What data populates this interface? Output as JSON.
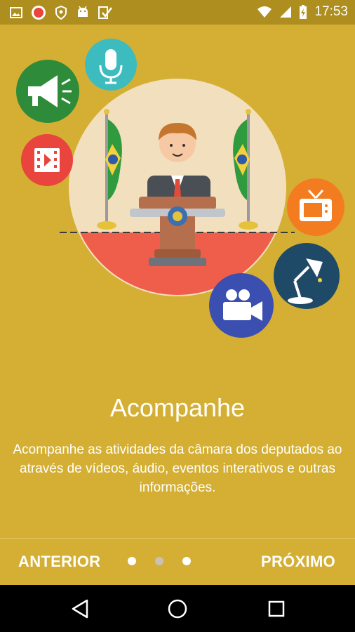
{
  "statusbar": {
    "time": "17:53",
    "icons": [
      "gallery-icon",
      "app-badge-icon",
      "shield-icon",
      "android-icon",
      "check-icon",
      "wifi-icon",
      "signal-icon",
      "battery-charging-icon"
    ]
  },
  "onboarding": {
    "title": "Acompanhe",
    "description": "Acompanhe as atividades da câmara dos deputados ao através de vídeos, áudio, eventos interativos e outras informações.",
    "prev_label": "ANTERIOR",
    "next_label": "PRÓXIMO",
    "page_count": 3,
    "current_page": 2
  },
  "illustration_icons": [
    "megaphone-icon",
    "microphone-icon",
    "video-icon",
    "tv-icon",
    "lamp-icon",
    "movie-camera-icon",
    "speaker-at-podium"
  ],
  "colors": {
    "background": "#D4AF33",
    "statusbar": "#AD8E1E",
    "green": "#2E8B3A",
    "teal": "#3DBCC0",
    "red": "#E9443D",
    "orange": "#F47C20",
    "navy": "#1F4A67",
    "indigo": "#3B4FB0"
  },
  "navbar": {
    "buttons": [
      "back-icon",
      "home-icon",
      "recents-icon"
    ]
  }
}
